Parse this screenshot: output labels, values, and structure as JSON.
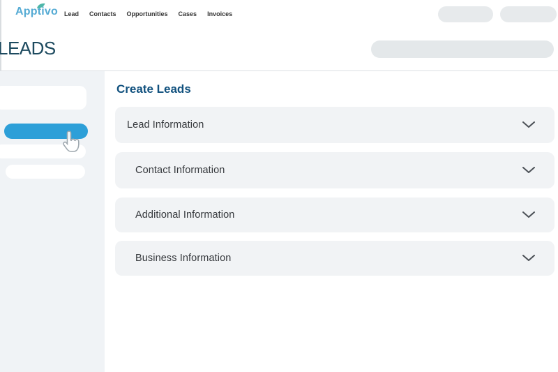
{
  "brand": {
    "name": "Apptivo"
  },
  "nav": {
    "items": [
      {
        "label": "Lead"
      },
      {
        "label": "Contacts"
      },
      {
        "label": "Opportunities"
      },
      {
        "label": "Cases"
      },
      {
        "label": "Invoices"
      }
    ]
  },
  "page": {
    "app_title": "LEADS"
  },
  "main": {
    "title": "Create Leads",
    "sections": [
      {
        "label": "Lead Information",
        "state": "collapsed"
      },
      {
        "label": "Contact Information",
        "state": "collapsed"
      },
      {
        "label": "Additional Information",
        "state": "collapsed"
      },
      {
        "label": "Business Information",
        "state": "collapsed"
      }
    ]
  },
  "icons": {
    "logo_leaf": "leaf-icon",
    "section_chevron": "chevron-down-icon",
    "cursor": "hand-pointer-cursor"
  },
  "colors": {
    "accent_blue": "#2d9fd8",
    "logo_blue": "#55abd4",
    "leaf_teal": "#4db6a8",
    "page_title_navy": "#11517e",
    "app_title_slate": "#1d4a5f",
    "card_bg": "#f1f3f5",
    "sidebar_bg": "#f0f3f6",
    "placeholder_gray": "#e7eaec"
  }
}
